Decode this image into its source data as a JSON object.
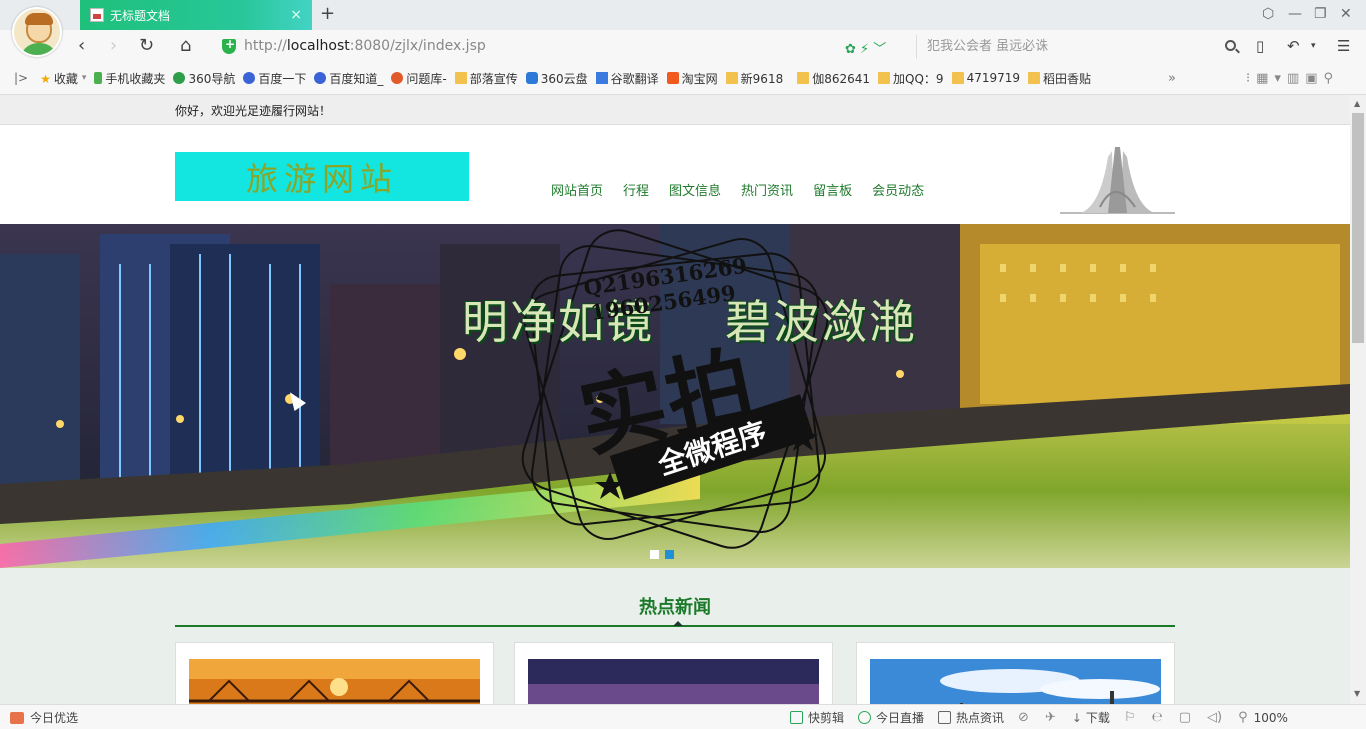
{
  "browser": {
    "tab": {
      "title": "无标题文档",
      "close": "×"
    },
    "new_tab": "+",
    "window_controls": [
      "⬡",
      "—",
      "❐",
      "✕"
    ],
    "nav": {
      "back": "‹",
      "forward": "›",
      "reload": "↻",
      "home": "⌂"
    },
    "url": {
      "prefix": "http://",
      "host": "localhost",
      "rest": ":8080/zjlx/index.jsp"
    },
    "search": {
      "placeholder": "犯我公会者 虽远必诛"
    },
    "bookmarks_expand": "|>",
    "bookmarks": [
      {
        "label": "收藏",
        "icon": "star"
      },
      {
        "label": "手机收藏夹",
        "icon": "phone"
      },
      {
        "label": "360导航",
        "icon": "round"
      },
      {
        "label": "百度一下",
        "icon": "paw"
      },
      {
        "label": "百度知道_",
        "icon": "paw"
      },
      {
        "label": "问题库-",
        "icon": "red"
      },
      {
        "label": "部落宣传",
        "icon": "folder"
      },
      {
        "label": "360云盘",
        "icon": "cloud"
      },
      {
        "label": "谷歌翻译",
        "icon": "g"
      },
      {
        "label": "淘宝网",
        "icon": "tb"
      },
      {
        "label": "新9618",
        "icon": "folder"
      },
      {
        "label": "伽862641",
        "icon": "folder"
      },
      {
        "label": "加QQ：9",
        "icon": "folder"
      },
      {
        "label": "4719719",
        "icon": "folder"
      },
      {
        "label": "稻田香贴",
        "icon": "folder"
      }
    ],
    "bookmarks_more": "»",
    "zoom": "100%"
  },
  "site": {
    "welcome": "你好，欢迎光足迹履行网站！",
    "logo_text": "旅游网站",
    "nav": [
      "网站首页",
      "行程",
      "图文信息",
      "热门资讯",
      "留言板",
      "会员动态"
    ],
    "banner": {
      "slogan_left": "明净如镜",
      "slogan_right": "碧波潋滟",
      "stamp_numbers": [
        "Q2196316269",
        "1960256499"
      ],
      "stamp_main": "实拍",
      "stamp_ribbon": "全微程序"
    },
    "section_title": "热点新闻"
  },
  "statusbar": {
    "left": "今日优选",
    "items": [
      "快剪辑",
      "今日直播",
      "热点资讯"
    ],
    "download": "下载"
  },
  "colors": {
    "tab_green": "#1ec07a",
    "logo_bg": "#13e6e0",
    "nav_green": "#1f7a2c",
    "section_green": "#1a7a2a",
    "page_bg": "#e9efea"
  }
}
